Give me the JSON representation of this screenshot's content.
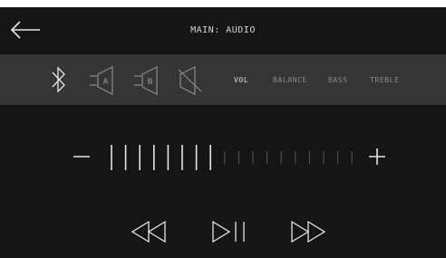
{
  "header": {
    "title": "MAIN: AUDIO",
    "back_icon": "arrow-left-icon"
  },
  "toolbar": {
    "icons": [
      "bluetooth-icon",
      "speaker-a-icon",
      "speaker-b-icon",
      "speaker-muted-icon"
    ],
    "speaker_a_label": "A",
    "speaker_b_label": "B",
    "tabs": [
      {
        "label": "VOL",
        "active": true
      },
      {
        "label": "BALANCE",
        "active": false
      },
      {
        "label": "BASS",
        "active": false
      },
      {
        "label": "TREBLE",
        "active": false
      }
    ]
  },
  "volume": {
    "decrease_icon": "minus-icon",
    "increase_icon": "plus-icon",
    "level": 8,
    "steps": 18
  },
  "playback": {
    "icons": [
      "rewind-icon",
      "play-pause-icon",
      "fast-forward-icon"
    ]
  },
  "colors": {
    "background": "#151515",
    "toolbar": "#343535",
    "foreground": "#e6e6e6",
    "inactive": "#8a8a8a",
    "level_dim": "#5a5a5a"
  }
}
